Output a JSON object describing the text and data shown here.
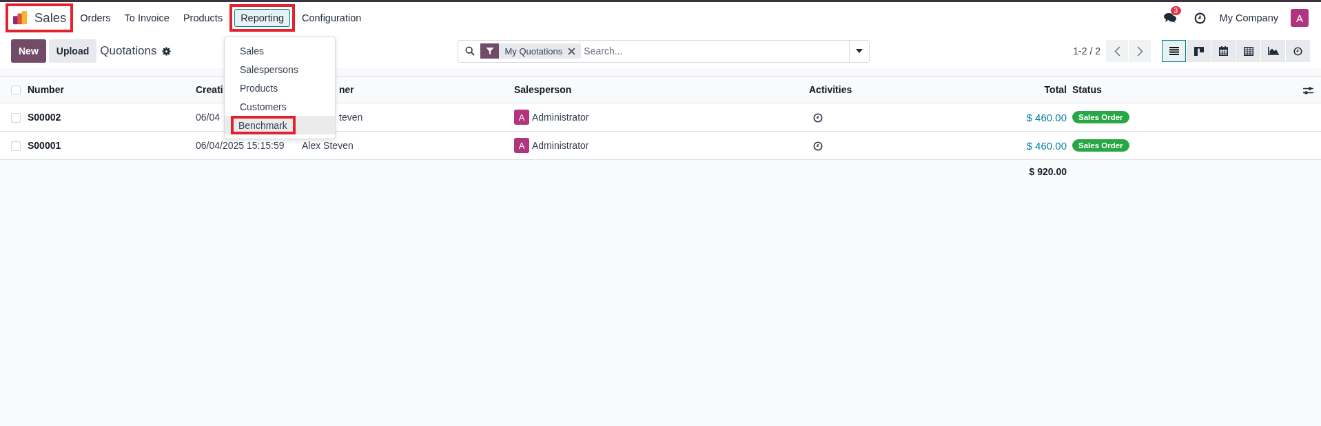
{
  "app": {
    "name": "Sales",
    "highlighted": true
  },
  "menu": [
    {
      "label": "Orders",
      "selected": false,
      "highlighted": false
    },
    {
      "label": "To Invoice",
      "selected": false,
      "highlighted": false
    },
    {
      "label": "Products",
      "selected": false,
      "highlighted": false
    },
    {
      "label": "Reporting",
      "selected": true,
      "highlighted": true
    },
    {
      "label": "Configuration",
      "selected": false,
      "highlighted": false
    }
  ],
  "systray": {
    "messages_badge": "3",
    "company": "My Company",
    "avatar": "A"
  },
  "dropdown": {
    "items": [
      {
        "label": "Sales",
        "hovered": false,
        "highlighted": false
      },
      {
        "label": "Salespersons",
        "hovered": false,
        "highlighted": false
      },
      {
        "label": "Products",
        "hovered": false,
        "highlighted": false
      },
      {
        "label": "Customers",
        "hovered": false,
        "highlighted": false
      },
      {
        "label": "Benchmark",
        "hovered": true,
        "highlighted": true
      }
    ]
  },
  "control_panel": {
    "buttons": [
      {
        "label": "New",
        "kind": "primary"
      },
      {
        "label": "Upload",
        "kind": "secondary"
      }
    ],
    "title": "Quotations",
    "search": {
      "facet": "My Quotations",
      "placeholder": "Search..."
    },
    "pager": "1-2 / 2",
    "views": [
      {
        "kind": "list",
        "selected": true
      },
      {
        "kind": "kanban",
        "selected": false
      },
      {
        "kind": "calendar",
        "selected": false
      },
      {
        "kind": "pivot",
        "selected": false
      },
      {
        "kind": "graph",
        "selected": false
      },
      {
        "kind": "activity",
        "selected": false
      }
    ]
  },
  "table": {
    "all_checked": false,
    "columns": [
      "Number",
      "Creati",
      "ner",
      "Salesperson",
      "Activities",
      "Total",
      "Status"
    ],
    "rows": [
      {
        "checked": false,
        "number": "S00002",
        "date": "06/04",
        "customer": "teven",
        "salesperson_avatar": "A",
        "salesperson": "Administrator",
        "total": "$ 460.00",
        "status": "Sales Order"
      },
      {
        "checked": false,
        "number": "S00001",
        "date": "06/04/2025 15:15:59",
        "customer": "Alex Steven",
        "salesperson_avatar": "A",
        "salesperson": "Administrator",
        "total": "$ 460.00",
        "status": "Sales Order"
      }
    ],
    "sum_total": "$ 920.00"
  }
}
